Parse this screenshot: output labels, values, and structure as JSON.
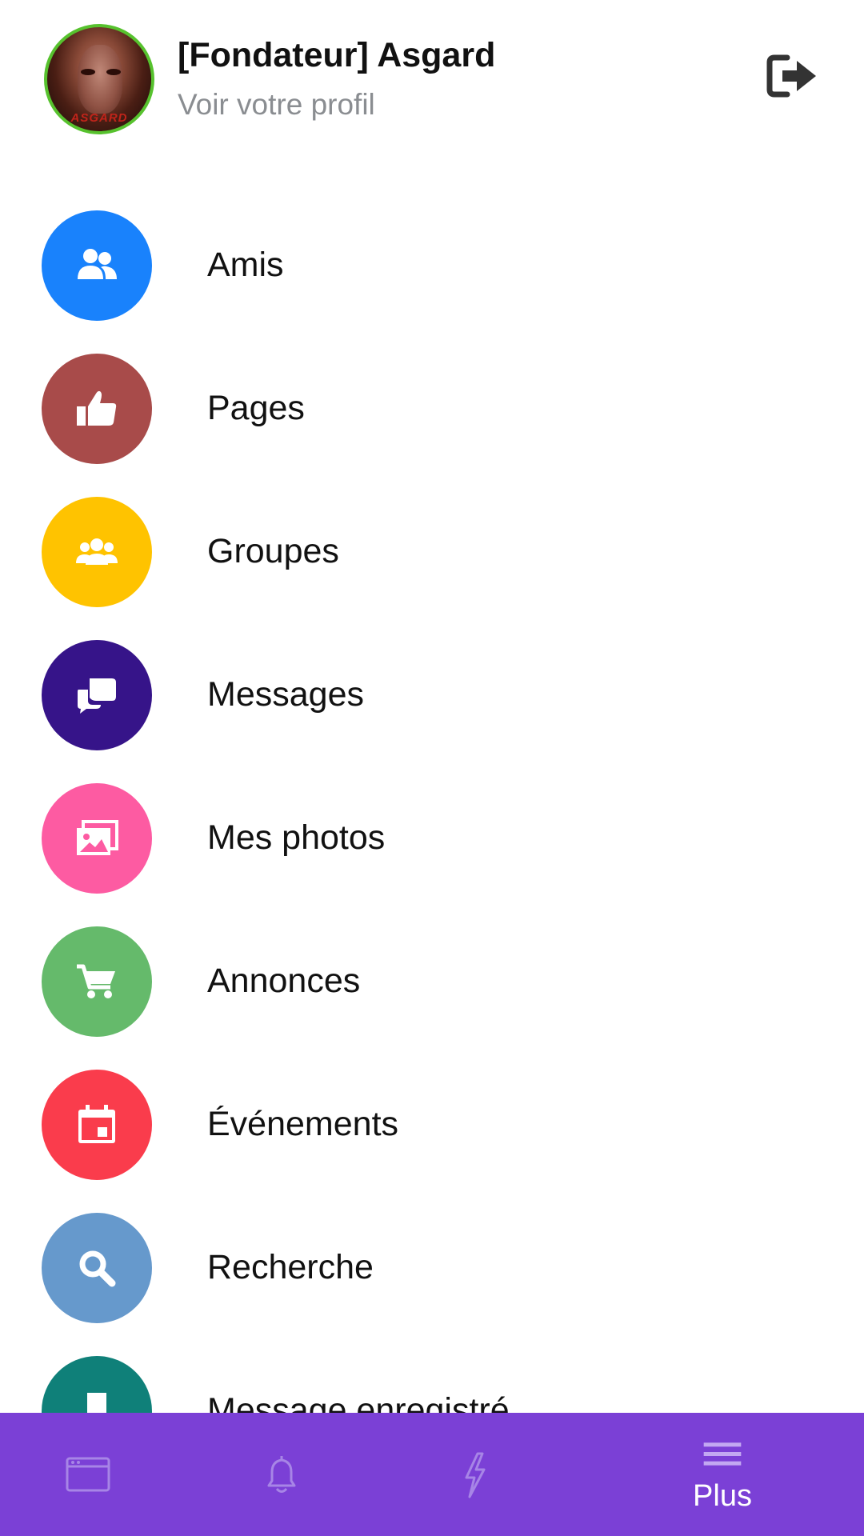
{
  "profile": {
    "name": "[Fondateur] Asgard",
    "subtitle": "Voir votre profil",
    "avatar_text": "ASGARD",
    "logout_icon": "logout-icon"
  },
  "menu": {
    "items": [
      {
        "label": "Amis",
        "icon": "friends-icon",
        "color": "#1982fc"
      },
      {
        "label": "Pages",
        "icon": "thumbs-up-icon",
        "color": "#a84b4a"
      },
      {
        "label": "Groupes",
        "icon": "groups-icon",
        "color": "#ffc300"
      },
      {
        "label": "Messages",
        "icon": "chat-icon",
        "color": "#361489"
      },
      {
        "label": "Mes photos",
        "icon": "photos-icon",
        "color": "#fd5ba2"
      },
      {
        "label": "Annonces",
        "icon": "cart-icon",
        "color": "#65ba6b"
      },
      {
        "label": "Événements",
        "icon": "calendar-icon",
        "color": "#fa3c4c"
      },
      {
        "label": "Recherche",
        "icon": "search-icon",
        "color": "#6699cc"
      },
      {
        "label": "Message enregistré",
        "icon": "bookmark-icon",
        "color": "#0f8079"
      }
    ]
  },
  "bottom_nav": {
    "background": "#7b40d6",
    "tabs": [
      {
        "icon": "newsfeed-icon",
        "label": ""
      },
      {
        "icon": "bell-icon",
        "label": ""
      },
      {
        "icon": "lightning-icon",
        "label": ""
      },
      {
        "icon": "menu-icon",
        "label": "Plus",
        "active": true
      }
    ]
  }
}
